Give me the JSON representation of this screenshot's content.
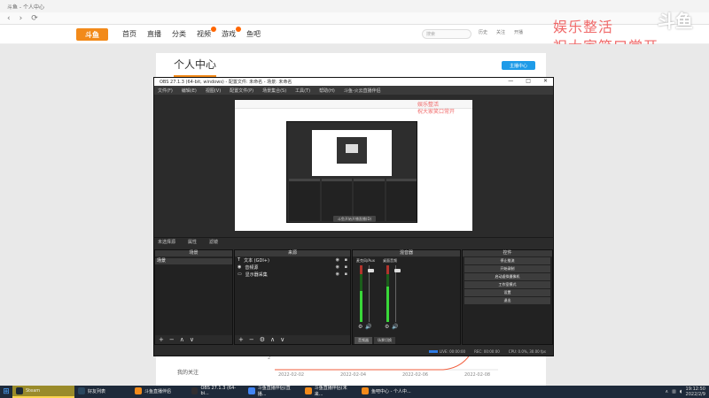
{
  "browser": {
    "tab_title": "斗鱼 - 个人中心",
    "back": "‹",
    "forward": "›",
    "refresh": "⟳"
  },
  "site": {
    "logo": "斗鱼",
    "nav": [
      "首页",
      "直播",
      "分类",
      "视频",
      "游戏",
      "鱼吧"
    ],
    "search_placeholder": "搜索",
    "user_links": [
      "历史",
      "关注",
      "开播"
    ]
  },
  "overlay": {
    "line1": "娱乐整活",
    "line2": "祝大家笑口常开"
  },
  "corner_logo": "斗鱼",
  "page": {
    "title": "个人中心",
    "anchor_button": "主播中心",
    "my_follow": "我的关注",
    "chart_dates": [
      "2022-02-02",
      "2022-02-04",
      "2022-02-06",
      "2022-02-08"
    ],
    "chart_y_tick": "2"
  },
  "obs": {
    "title": "OBS 27.1.3 (64-bit, windows) - 配置文件: 未命名 - 场景: 未命名",
    "menu": [
      "文件(F)",
      "编辑(E)",
      "视图(V)",
      "配置文件(P)",
      "场景集合(S)",
      "工具(T)",
      "帮助(H)",
      "斗鱼-火云直播伴侣"
    ],
    "nested_start_label": "斗鱼开始开播直播(D)",
    "nested_overlay_1": "娱乐整活",
    "nested_overlay_2": "祝大家笑口常开",
    "scene_bar": [
      "未选择源",
      "属性",
      "滤镜"
    ],
    "docks": {
      "scenes_title": "场景",
      "sources_title": "来源",
      "mixer_title": "混音器",
      "controls_title": "控件"
    },
    "scenes": [
      "场景"
    ],
    "sources": [
      {
        "icon": "T",
        "label": "文本 (GDI+)"
      },
      {
        "icon": "◉",
        "label": "音频源"
      },
      {
        "icon": "▭",
        "label": "显示器采集"
      }
    ],
    "mixer_channels": [
      {
        "label": "麦克风/Aux",
        "level": 0.55
      },
      {
        "label": "桌面音频",
        "level": 0.62
      }
    ],
    "mixer_tabs": [
      "音频器",
      "场景切换"
    ],
    "controls": [
      "停止推流",
      "开始录制",
      "启动虚拟摄像机",
      "工作室模式",
      "设置",
      "退出"
    ],
    "dock_footer": [
      "+",
      "−",
      "∧",
      "∨"
    ],
    "sources_footer": [
      "+",
      "−",
      "⚙",
      "∧",
      "∨"
    ],
    "status": {
      "live": "LIVE: 00:00:00",
      "rec": "REC: 00:00:00",
      "cpu": "CPU: 0.0%, 30.00 fps"
    }
  },
  "taskbar": {
    "items": [
      {
        "label": "Steam",
        "active": true,
        "color": "#1b2838"
      },
      {
        "label": "好友列表",
        "active": false,
        "color": "#2a475e"
      },
      {
        "label": "斗鱼直播伴侣",
        "active": false,
        "color": "#f28a1a"
      },
      {
        "label": "OBS 27.1.3 (64-bi...",
        "active": false,
        "color": "#302e31"
      },
      {
        "label": "斗鱼直播伴侣(直播...",
        "active": false,
        "color": "#4285f4"
      },
      {
        "label": "斗鱼直播伴侣(未来...",
        "active": false,
        "color": "#f28a1a"
      },
      {
        "label": "鱼吧中心 - 个人中...",
        "active": false,
        "color": "#f28a1a"
      }
    ],
    "time": "19:12:50",
    "date": "2022/2/9"
  }
}
